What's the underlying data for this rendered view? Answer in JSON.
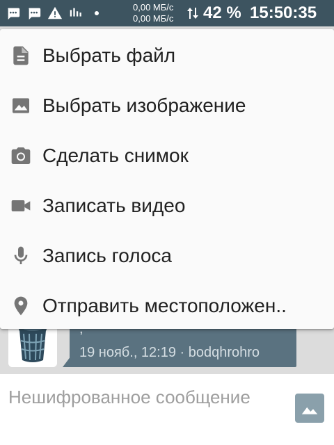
{
  "status_bar": {
    "speed_up": "0,00 МБ/с",
    "speed_down": "0,00 МБ/с",
    "battery": "42 %",
    "time": "15:50:35",
    "icons": [
      "chat-bubble-icon",
      "chat-bubble-icon",
      "warning-icon",
      "signal-bars-icon",
      "dot-icon",
      "data-arrows-icon"
    ]
  },
  "menu": {
    "items": [
      {
        "label": "Выбрать файл",
        "icon": "file-icon"
      },
      {
        "label": "Выбрать изображение",
        "icon": "image-icon"
      },
      {
        "label": "Сделать снимок",
        "icon": "camera-icon"
      },
      {
        "label": "Записать видео",
        "icon": "video-camera-icon"
      },
      {
        "label": "Запись голоса",
        "icon": "microphone-icon"
      },
      {
        "label": "Отправить местоположен..",
        "icon": "location-pin-icon"
      }
    ]
  },
  "message": {
    "text": ",",
    "meta": "19 нояб., 12:19 · bodqhrohro"
  },
  "composer": {
    "placeholder": "Нешифрованное сообщение",
    "attach_icon": "image-icon"
  },
  "colors": {
    "status_bar": "#3d5460",
    "bubble": "#5a7280",
    "menu_bg": "#fafafa",
    "menu_icon": "#757575",
    "menu_text": "#212121"
  }
}
